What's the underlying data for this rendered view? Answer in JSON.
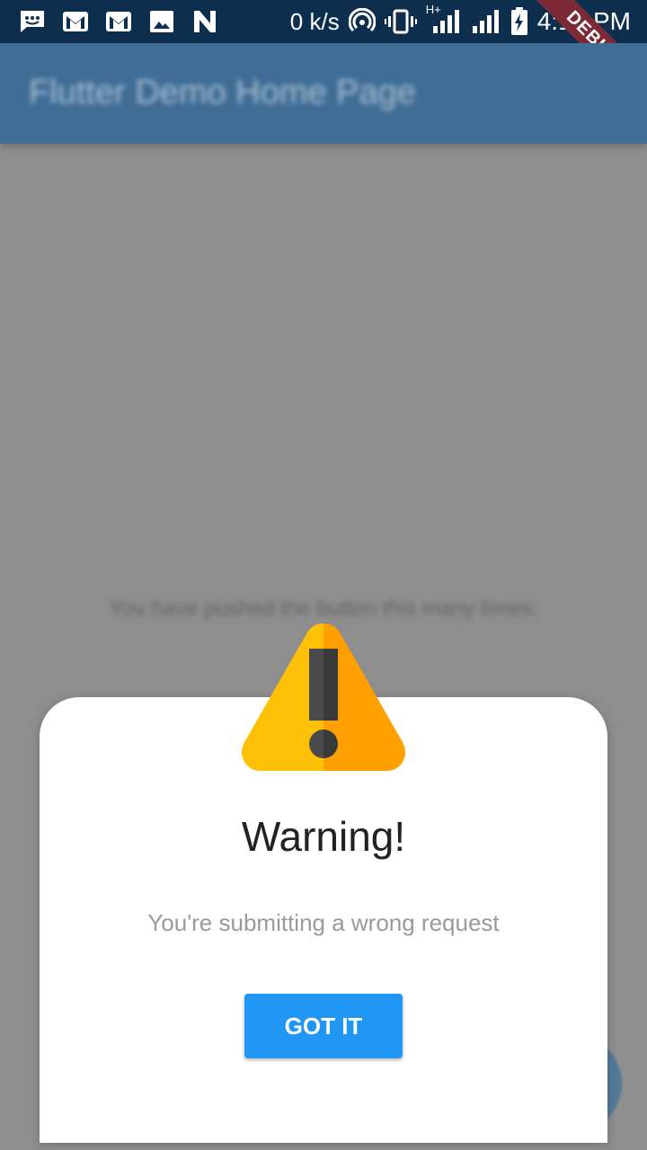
{
  "status_bar": {
    "left_icons": [
      "messages-icon",
      "gmail-icon",
      "gmail-icon",
      "image-icon",
      "n-app-icon"
    ],
    "network_speed": "0 k/s",
    "right_icons": [
      "hotspot-icon",
      "vibrate-icon",
      "signal-icon",
      "signal-icon",
      "battery-charging-icon"
    ],
    "network_type": "H+",
    "time": "4:19 PM"
  },
  "app_bar": {
    "title": "Flutter Demo Home Page"
  },
  "debug_banner": "DEBUG",
  "body": {
    "counter_label": "You have pushed the button this many times:"
  },
  "dialog": {
    "icon": "warning-icon",
    "title": "Warning!",
    "message": "You're submitting a wrong request",
    "button_label": "GOT IT"
  },
  "colors": {
    "status_bar": "#0d2e4d",
    "app_bar": "#3f6d96",
    "scrim": "#8e8e8e",
    "button": "#2196f3",
    "warning_yellow": "#ffc107",
    "warning_orange": "#ffa000"
  }
}
